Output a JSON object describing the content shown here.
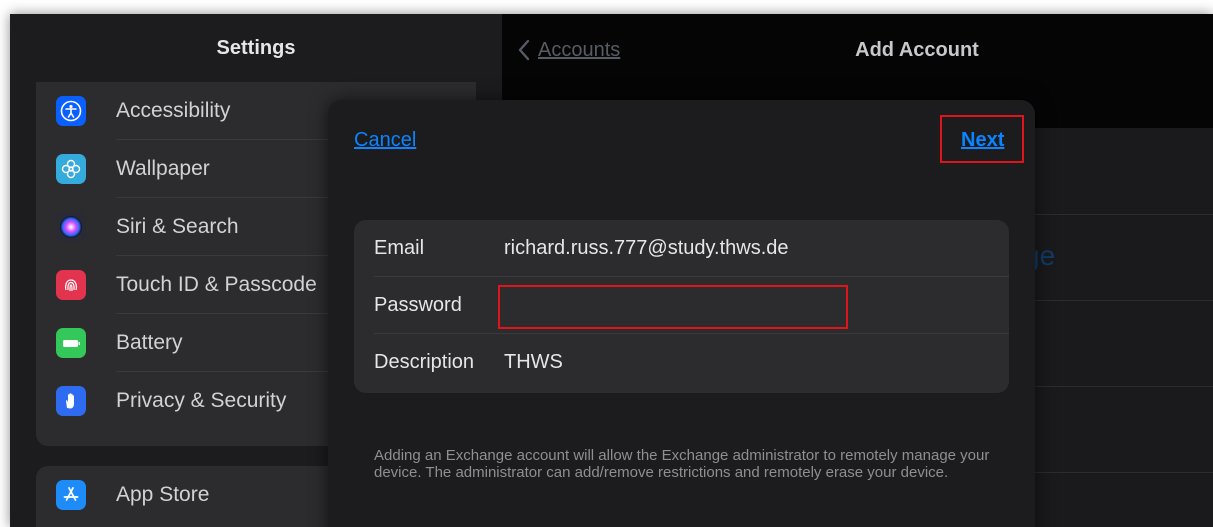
{
  "settings": {
    "title": "Settings",
    "items": [
      {
        "label": "Accessibility",
        "icon": "accessibility-icon",
        "color": "#0a60ff",
        "glyph": "♿"
      },
      {
        "label": "Wallpaper",
        "icon": "wallpaper-flower-icon",
        "color": "#35aadc",
        "glyph": "❀"
      },
      {
        "label": "Siri & Search",
        "icon": "siri-icon",
        "color": "#333340",
        "glyph": "●"
      },
      {
        "label": "Touch ID & Passcode",
        "icon": "fingerprint-icon",
        "color": "#e3344f",
        "glyph": "◉"
      },
      {
        "label": "Battery",
        "icon": "battery-icon",
        "color": "#34c759",
        "glyph": "▬"
      },
      {
        "label": "Privacy & Security",
        "icon": "hand-icon",
        "color": "#2f6bf0",
        "glyph": "✋"
      }
    ],
    "second_group": [
      {
        "label": "App Store",
        "icon": "app-store-icon",
        "color": "#1d8cf8",
        "glyph": "A"
      }
    ]
  },
  "right": {
    "back_label": "Accounts",
    "title": "Add Account",
    "peek_text": "ge"
  },
  "modal": {
    "cancel_label": "Cancel",
    "next_label": "Next",
    "fields": {
      "email_label": "Email",
      "email_value": "richard.russ.777@study.thws.de",
      "password_label": "Password",
      "password_value": "",
      "description_label": "Description",
      "description_value": "THWS"
    },
    "note": "Adding an Exchange account will allow the Exchange administrator to remotely manage your device. The administrator can add/remove restrictions and remotely erase your device."
  },
  "colors": {
    "accent": "#0a84ff",
    "highlight": "#e0141b"
  }
}
